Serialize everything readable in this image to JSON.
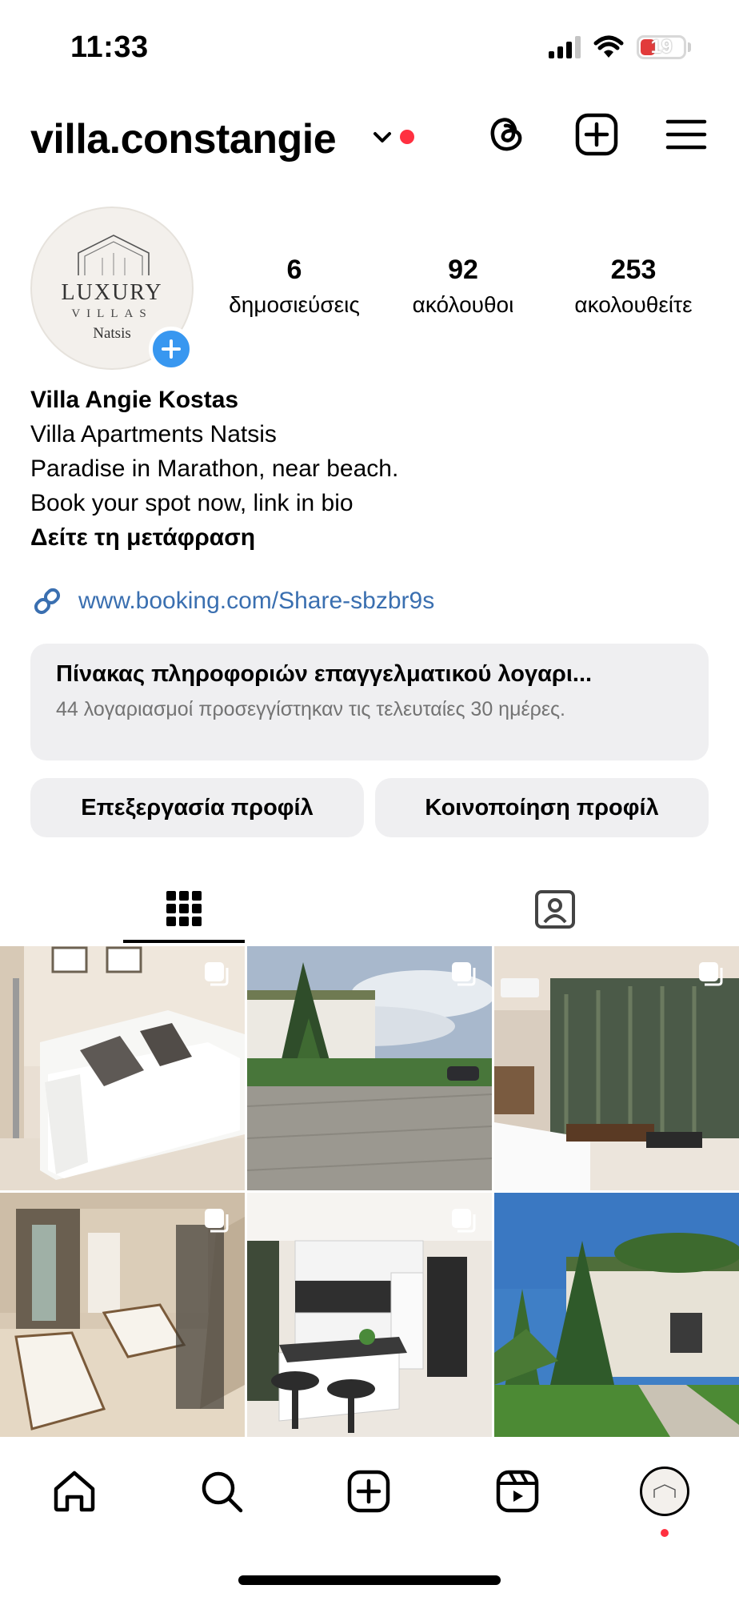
{
  "status_bar": {
    "time": "11:33",
    "battery": "19"
  },
  "header": {
    "username": "villa.constangie",
    "icons": [
      "chevron-down-icon",
      "threads-icon",
      "add-icon",
      "menu-icon"
    ]
  },
  "profile": {
    "avatar_logo": {
      "line1": "LUXURY",
      "line2": "VILLAS",
      "line3": "Natsis"
    },
    "stats": [
      {
        "value": "6",
        "label": "δημοσιεύσεις"
      },
      {
        "value": "92",
        "label": "ακόλουθοι"
      },
      {
        "value": "253",
        "label": "ακολουθείτε"
      }
    ],
    "name": "Villa Angie Kostas",
    "bio_lines": [
      "Villa Apartments Natsis",
      "Paradise in Marathon, near beach.",
      "Book your spot now, link in bio"
    ],
    "translate": "Δείτε τη μετάφραση",
    "link": "www.booking.com/Share-sbzbr9s"
  },
  "dashboard": {
    "title": "Πίνακας πληροφοριών επαγγελματικού λογαρι...",
    "subtitle": "44 λογαριασμοί προσεγγίστηκαν τις τελευταίες 30 ημέρες."
  },
  "buttons": {
    "edit": "Επεξεργασία προφίλ",
    "share": "Κοινοποίηση προφίλ"
  },
  "tabs": [
    {
      "name": "grid",
      "icon": "grid-icon",
      "active": true
    },
    {
      "name": "tagged",
      "icon": "tagged-icon",
      "active": false
    }
  ],
  "posts": [
    {
      "subject": "white sofa living room",
      "multi": true
    },
    {
      "subject": "villa courtyard with trees",
      "multi": true
    },
    {
      "subject": "living room with glass door",
      "multi": true
    },
    {
      "subject": "bedroom with single beds",
      "multi": true
    },
    {
      "subject": "white kitchen with island",
      "multi": true
    },
    {
      "subject": "villa exterior with garden",
      "multi": false
    }
  ],
  "bottom_nav": [
    "home-icon",
    "search-icon",
    "create-icon",
    "reels-icon",
    "profile-icon"
  ],
  "colors": {
    "accent_blue": "#3897f0",
    "link_blue": "#3a6fb0",
    "notification_red": "#ff3040"
  }
}
